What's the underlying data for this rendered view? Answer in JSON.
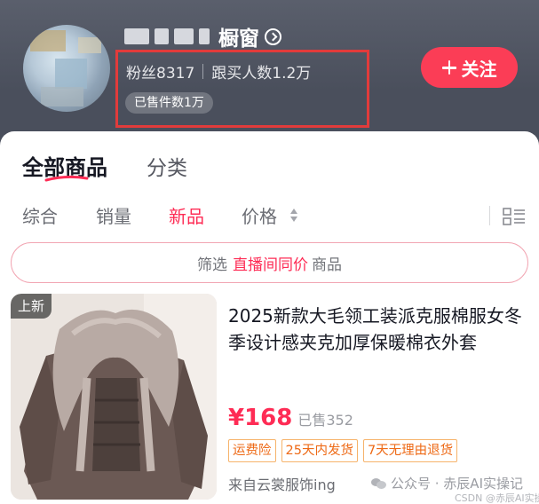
{
  "header": {
    "store_name": "橱窗",
    "fans_label": "粉丝8317",
    "buyers_label": "跟买人数1.2万",
    "sold_label": "已售件数1万",
    "follow_label": "关注",
    "icons": [
      "avatar",
      "circle-arrow-right-icon",
      "plus-icon"
    ]
  },
  "tabs": {
    "all_products": "全部商品",
    "categories": "分类"
  },
  "sort": {
    "comprehensive": "综合",
    "sales": "销量",
    "new": "新品",
    "price": "价格"
  },
  "filter": {
    "prefix": "筛选",
    "highlight": "直播间同价",
    "suffix": "商品"
  },
  "product": {
    "tag": "上新",
    "title": "2025新款大毛领工装派克服棉服女冬季设计感夹克加厚保暖棉衣外套",
    "price": "¥168",
    "sold": "已售352",
    "badges": [
      "运费险",
      "25天内发货",
      "7天无理由退货"
    ],
    "shop": "来自云裳服饰ing"
  },
  "watermark": {
    "text": "公众号 · 赤辰AI实操记",
    "csdn": "CSDN @赤辰AI实操记"
  },
  "colors": {
    "accent": "#fe2c55",
    "highlight_box": "#e23b3b",
    "badge": "#ee6a16",
    "header_bg": "#4f5461"
  }
}
